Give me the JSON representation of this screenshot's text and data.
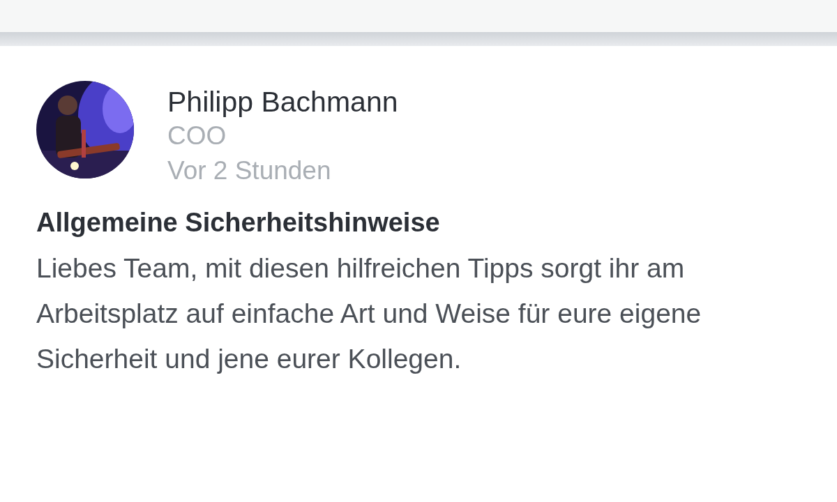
{
  "author": {
    "name": "Philipp Bachmann",
    "role": "COO",
    "time": "Vor 2 Stunden"
  },
  "post": {
    "title": "Allgemeine Sicherheitshinweise",
    "body": "Liebes Team, mit diesen hilfreichen Tipps sorgt ihr am Arbeitsplatz auf einfache Art und Weise für eure eigene Sicherheit und jene eurer Kollegen."
  }
}
